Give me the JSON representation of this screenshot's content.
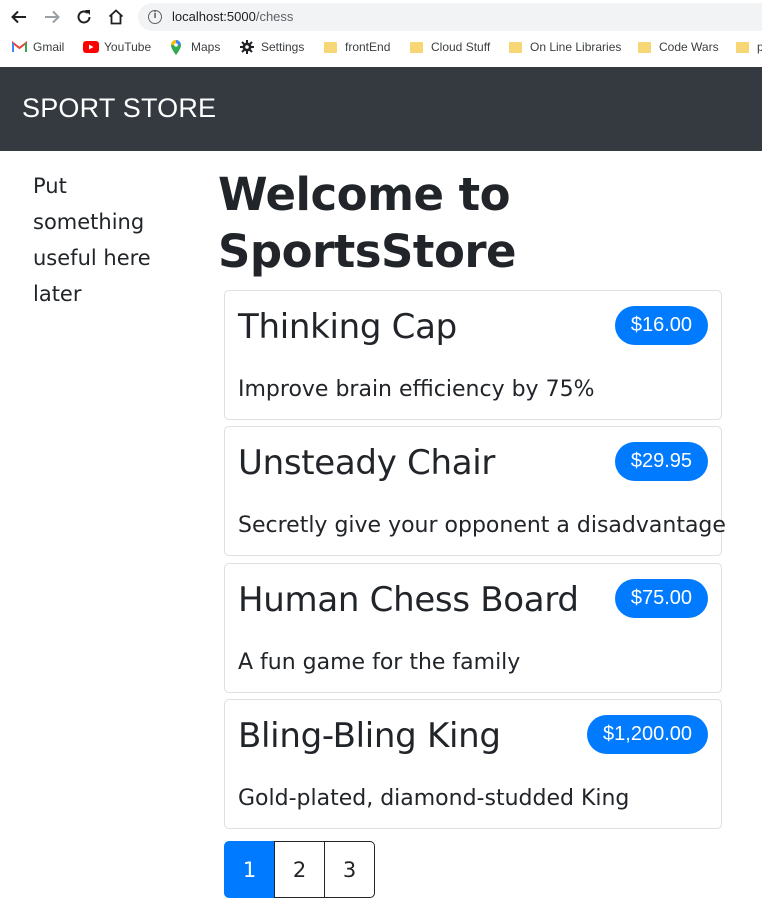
{
  "browser": {
    "url_host": "localhost:5000",
    "url_path": "/chess",
    "bookmarks": [
      {
        "label": "Gmail",
        "icon": "gmail-icon"
      },
      {
        "label": "YouTube",
        "icon": "youtube-icon"
      },
      {
        "label": "Maps",
        "icon": "maps-icon"
      },
      {
        "label": "Settings",
        "icon": "gear-icon"
      },
      {
        "label": "frontEnd",
        "icon": "folder-icon"
      },
      {
        "label": "Cloud Stuff",
        "icon": "folder-icon"
      },
      {
        "label": "On Line Libraries",
        "icon": "folder-icon"
      },
      {
        "label": "Code Wars",
        "icon": "folder-icon"
      },
      {
        "label": "p",
        "icon": "folder-icon"
      }
    ]
  },
  "navbar": {
    "brand": "SPORT STORE",
    "background": "#343a40"
  },
  "sidebar": {
    "text": "Put something useful here later"
  },
  "main": {
    "title": "Welcome to SportsStore",
    "products": [
      {
        "name": "Thinking Cap",
        "price": "$16.00",
        "description": "Improve brain efficiency by 75%"
      },
      {
        "name": "Unsteady Chair",
        "price": "$29.95",
        "description": "Secretly give your opponent a disadvantage"
      },
      {
        "name": "Human Chess Board",
        "price": "$75.00",
        "description": "A fun game for the family"
      },
      {
        "name": "Bling-Bling King",
        "price": "$1,200.00",
        "description": "Gold-plated, diamond-studded King"
      }
    ],
    "pagination": {
      "pages": [
        "1",
        "2",
        "3"
      ],
      "active": "1"
    }
  },
  "colors": {
    "accent": "#007bff"
  }
}
